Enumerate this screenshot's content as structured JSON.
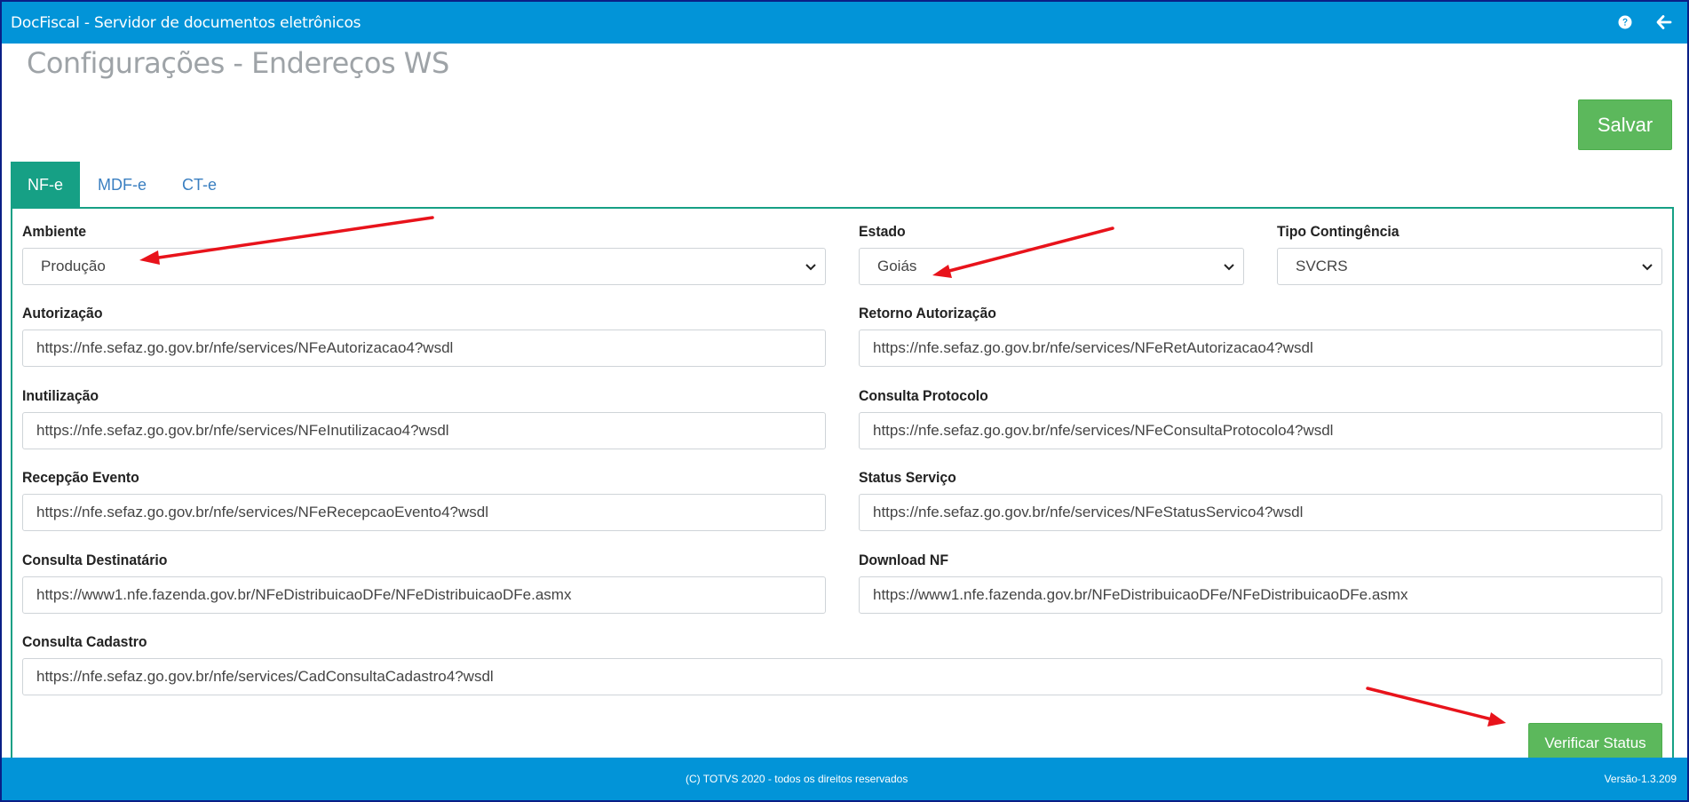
{
  "app": {
    "title": "DocFiscal - Servidor de documentos eletrônicos",
    "help_icon": "question-circle-icon",
    "back_icon": "arrow-left-icon"
  },
  "page": {
    "title": "Configurações - Endereços WS",
    "save_label": "Salvar"
  },
  "tabs": [
    {
      "label": "NF-e",
      "active": true
    },
    {
      "label": "MDF-e",
      "active": false
    },
    {
      "label": "CT-e",
      "active": false
    }
  ],
  "form": {
    "ambiente": {
      "label": "Ambiente",
      "value": "Produção"
    },
    "estado": {
      "label": "Estado",
      "value": "Goiás"
    },
    "tipo_contingencia": {
      "label": "Tipo Contingência",
      "value": "SVCRS"
    },
    "autorizacao": {
      "label": "Autorização",
      "value": "https://nfe.sefaz.go.gov.br/nfe/services/NFeAutorizacao4?wsdl"
    },
    "retorno_autorizacao": {
      "label": "Retorno Autorização",
      "value": "https://nfe.sefaz.go.gov.br/nfe/services/NFeRetAutorizacao4?wsdl"
    },
    "inutilizacao": {
      "label": "Inutilização",
      "value": "https://nfe.sefaz.go.gov.br/nfe/services/NFeInutilizacao4?wsdl"
    },
    "consulta_protocolo": {
      "label": "Consulta Protocolo",
      "value": "https://nfe.sefaz.go.gov.br/nfe/services/NFeConsultaProtocolo4?wsdl"
    },
    "recepcao_evento": {
      "label": "Recepção Evento",
      "value": "https://nfe.sefaz.go.gov.br/nfe/services/NFeRecepcaoEvento4?wsdl"
    },
    "status_servico": {
      "label": "Status Serviço",
      "value": "https://nfe.sefaz.go.gov.br/nfe/services/NFeStatusServico4?wsdl"
    },
    "consulta_destinatario": {
      "label": "Consulta Destinatário",
      "value": "https://www1.nfe.fazenda.gov.br/NFeDistribuicaoDFe/NFeDistribuicaoDFe.asmx"
    },
    "download_nf": {
      "label": "Download NF",
      "value": "https://www1.nfe.fazenda.gov.br/NFeDistribuicaoDFe/NFeDistribuicaoDFe.asmx"
    },
    "consulta_cadastro": {
      "label": "Consulta Cadastro",
      "value": "https://nfe.sefaz.go.gov.br/nfe/services/CadConsultaCadastro4?wsdl"
    },
    "verify_label": "Verificar Status"
  },
  "footer": {
    "copyright": "(C) TOTVS 2020 - todos os direitos reservados",
    "version": "Versão-1.3.209"
  },
  "colors": {
    "header": "#0294d8",
    "tab_active": "#16a085",
    "button": "#5cb85c",
    "annotation_arrow": "#e8131b"
  }
}
